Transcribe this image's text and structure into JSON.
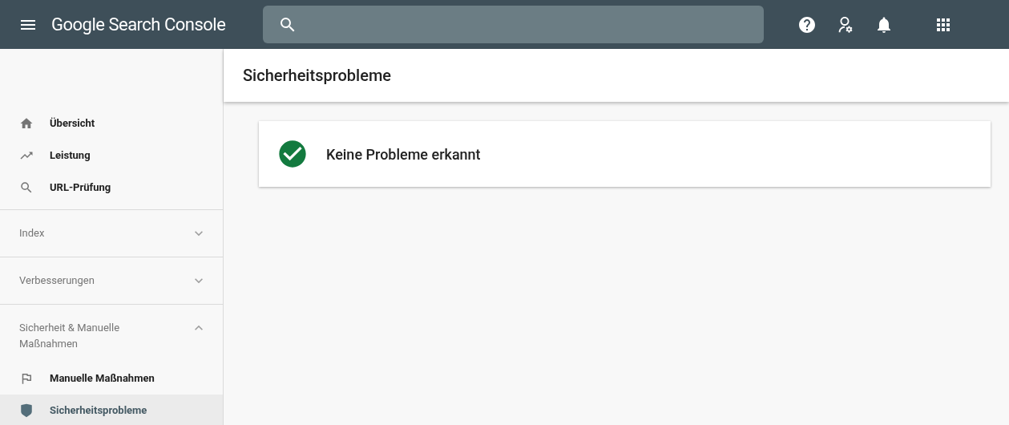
{
  "header": {
    "title": "Google Search Console"
  },
  "sidebar": {
    "items": [
      {
        "label": "Übersicht",
        "selected": false
      },
      {
        "label": "Leistung",
        "selected": false
      },
      {
        "label": "URL-Prüfung",
        "selected": false
      }
    ],
    "sections": [
      {
        "label": "Index",
        "expanded": false
      },
      {
        "label": "Verbesserungen",
        "expanded": false
      },
      {
        "label": "Sicherheit & Manuelle Maßnahmen",
        "expanded": true,
        "children": [
          {
            "label": "Manuelle Maßnahmen",
            "selected": false
          },
          {
            "label": "Sicherheitsprobleme",
            "selected": true
          }
        ]
      }
    ]
  },
  "page": {
    "title": "Sicherheitsprobleme",
    "status": {
      "kind": "ok",
      "message": "Keine Probleme erkannt"
    }
  }
}
